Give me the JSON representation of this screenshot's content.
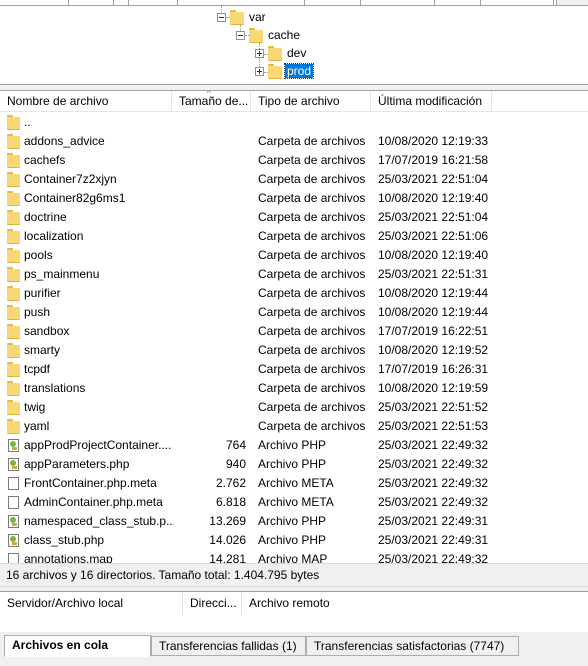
{
  "tree": {
    "nodes": [
      {
        "label": "var",
        "expander": "minus",
        "selected": false
      },
      {
        "label": "cache",
        "expander": "minus",
        "selected": false
      },
      {
        "label": "dev",
        "expander": "plus",
        "selected": false
      },
      {
        "label": "prod",
        "expander": "plus",
        "selected": true
      }
    ]
  },
  "file_list": {
    "columns": [
      "Nombre de archivo",
      "Tamaño de...",
      "Tipo de archivo",
      "Última modificación"
    ],
    "rows": [
      {
        "name": "..",
        "size": "",
        "type": "",
        "modified": "",
        "icon": "folder-icon"
      },
      {
        "name": "addons_advice",
        "size": "",
        "type": "Carpeta de archivos",
        "modified": "10/08/2020 12:19:33",
        "icon": "folder-icon"
      },
      {
        "name": "cachefs",
        "size": "",
        "type": "Carpeta de archivos",
        "modified": "17/07/2019 16:21:58",
        "icon": "folder-icon"
      },
      {
        "name": "Container7z2xjyn",
        "size": "",
        "type": "Carpeta de archivos",
        "modified": "25/03/2021 22:51:04",
        "icon": "folder-icon"
      },
      {
        "name": "Container82g6ms1",
        "size": "",
        "type": "Carpeta de archivos",
        "modified": "10/08/2020 12:19:40",
        "icon": "folder-icon"
      },
      {
        "name": "doctrine",
        "size": "",
        "type": "Carpeta de archivos",
        "modified": "25/03/2021 22:51:04",
        "icon": "folder-icon"
      },
      {
        "name": "localization",
        "size": "",
        "type": "Carpeta de archivos",
        "modified": "25/03/2021 22:51:06",
        "icon": "folder-icon"
      },
      {
        "name": "pools",
        "size": "",
        "type": "Carpeta de archivos",
        "modified": "10/08/2020 12:19:40",
        "icon": "folder-icon"
      },
      {
        "name": "ps_mainmenu",
        "size": "",
        "type": "Carpeta de archivos",
        "modified": "25/03/2021 22:51:31",
        "icon": "folder-icon"
      },
      {
        "name": "purifier",
        "size": "",
        "type": "Carpeta de archivos",
        "modified": "10/08/2020 12:19:44",
        "icon": "folder-icon"
      },
      {
        "name": "push",
        "size": "",
        "type": "Carpeta de archivos",
        "modified": "10/08/2020 12:19:44",
        "icon": "folder-icon"
      },
      {
        "name": "sandbox",
        "size": "",
        "type": "Carpeta de archivos",
        "modified": "17/07/2019 16:22:51",
        "icon": "folder-icon"
      },
      {
        "name": "smarty",
        "size": "",
        "type": "Carpeta de archivos",
        "modified": "10/08/2020 12:19:52",
        "icon": "folder-icon"
      },
      {
        "name": "tcpdf",
        "size": "",
        "type": "Carpeta de archivos",
        "modified": "17/07/2019 16:26:31",
        "icon": "folder-icon"
      },
      {
        "name": "translations",
        "size": "",
        "type": "Carpeta de archivos",
        "modified": "10/08/2020 12:19:59",
        "icon": "folder-icon"
      },
      {
        "name": "twig",
        "size": "",
        "type": "Carpeta de archivos",
        "modified": "25/03/2021 22:51:52",
        "icon": "folder-icon"
      },
      {
        "name": "yaml",
        "size": "",
        "type": "Carpeta de archivos",
        "modified": "25/03/2021 22:51:53",
        "icon": "folder-icon"
      },
      {
        "name": "appProdProjectContainer....",
        "size": "764",
        "type": "Archivo PHP",
        "modified": "25/03/2021 22:49:32",
        "icon": "php-file-icon"
      },
      {
        "name": "appParameters.php",
        "size": "940",
        "type": "Archivo PHP",
        "modified": "25/03/2021 22:49:32",
        "icon": "php-file-icon"
      },
      {
        "name": "FrontContainer.php.meta",
        "size": "2.762",
        "type": "Archivo META",
        "modified": "25/03/2021 22:49:32",
        "icon": "file-icon"
      },
      {
        "name": "AdminContainer.php.meta",
        "size": "6.818",
        "type": "Archivo META",
        "modified": "25/03/2021 22:49:32",
        "icon": "file-icon"
      },
      {
        "name": "namespaced_class_stub.p...",
        "size": "13.269",
        "type": "Archivo PHP",
        "modified": "25/03/2021 22:49:31",
        "icon": "php-file-icon"
      },
      {
        "name": "class_stub.php",
        "size": "14.026",
        "type": "Archivo PHP",
        "modified": "25/03/2021 22:49:31",
        "icon": "php-file-icon"
      },
      {
        "name": "annotations.map",
        "size": "14.281",
        "type": "Archivo MAP",
        "modified": "25/03/2021 22:49:32",
        "icon": "file-icon"
      }
    ]
  },
  "status_bar": {
    "text": "16 archivos y 16 directorios. Tamaño total: 1.404.795 bytes"
  },
  "queue": {
    "columns": [
      "Servidor/Archivo local",
      "Direcci...",
      "Archivo remoto"
    ]
  },
  "tabs": [
    {
      "label": "Archivos en cola",
      "active": true
    },
    {
      "label": "Transferencias fallidas (1)",
      "active": false
    },
    {
      "label": "Transferencias satisfactorias (7747)",
      "active": false
    }
  ],
  "colors": {
    "selection": "#0078d7",
    "folder": "#f8d775",
    "panel": "#f0f0f0"
  }
}
